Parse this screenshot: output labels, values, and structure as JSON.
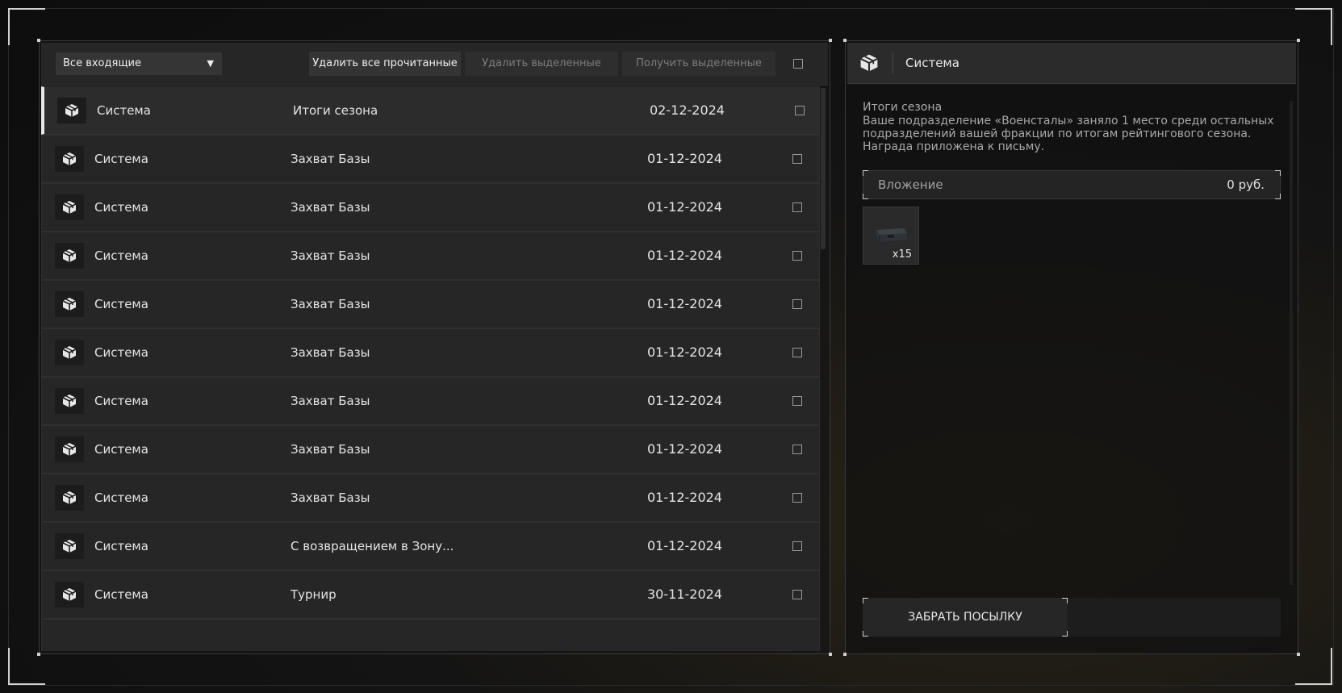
{
  "toolbar": {
    "filter_selected": "Все входящие",
    "delete_read_label": "Удалить все прочитанные",
    "delete_selected_label": "Удалить выделенные",
    "receive_selected_label": "Получить выделенные"
  },
  "messages": [
    {
      "sender": "Система",
      "subject": "Итоги сезона",
      "date": "02-12-2024"
    },
    {
      "sender": "Система",
      "subject": "Захват Базы",
      "date": "01-12-2024"
    },
    {
      "sender": "Система",
      "subject": "Захват Базы",
      "date": "01-12-2024"
    },
    {
      "sender": "Система",
      "subject": "Захват Базы",
      "date": "01-12-2024"
    },
    {
      "sender": "Система",
      "subject": "Захват Базы",
      "date": "01-12-2024"
    },
    {
      "sender": "Система",
      "subject": "Захват Базы",
      "date": "01-12-2024"
    },
    {
      "sender": "Система",
      "subject": "Захват Базы",
      "date": "01-12-2024"
    },
    {
      "sender": "Система",
      "subject": "Захват Базы",
      "date": "01-12-2024"
    },
    {
      "sender": "Система",
      "subject": "Захват Базы",
      "date": "01-12-2024"
    },
    {
      "sender": "Система",
      "subject": "С возвращением в Зону...",
      "date": "01-12-2024"
    },
    {
      "sender": "Система",
      "subject": "Турнир",
      "date": "30-11-2024"
    }
  ],
  "detail": {
    "sender": "Система",
    "title": "Итоги сезона",
    "body": "Ваше подразделение «Военсталы» заняло 1 место среди остальных подразделений вашей фракции по итогам рейтингового сезона. Награда приложена к письму.",
    "attachment_label": "Вложение",
    "attachment_price": "0 руб.",
    "item_count": "x15",
    "claim_label": "ЗАБРАТЬ ПОСЫЛКУ"
  },
  "icons": {
    "message_icon": "package-box-icon"
  }
}
